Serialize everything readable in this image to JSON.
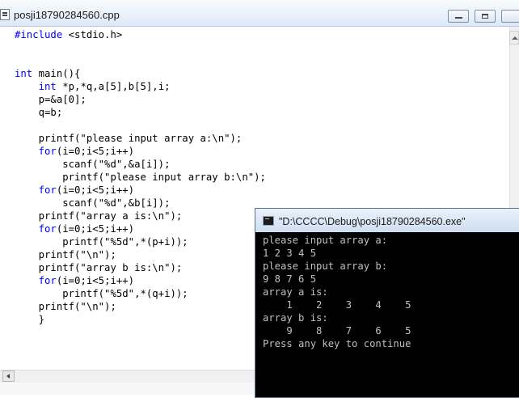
{
  "editor": {
    "title": "posji18790284560.cpp",
    "code_lines": [
      [
        {
          "t": "#include",
          "k": 1
        },
        {
          "t": " <stdio.h>"
        }
      ],
      [],
      [],
      [
        {
          "t": "int",
          "k": 1
        },
        {
          "t": " main(){"
        }
      ],
      [
        {
          "t": "    "
        },
        {
          "t": "int",
          "k": 1
        },
        {
          "t": " *p,*q,a[5],b[5],i;"
        }
      ],
      [
        {
          "t": "    p=&a[0];"
        }
      ],
      [
        {
          "t": "    q=b;"
        }
      ],
      [],
      [
        {
          "t": "    printf(\"please input array a:\\n\");"
        }
      ],
      [
        {
          "t": "    "
        },
        {
          "t": "for",
          "k": 1
        },
        {
          "t": "(i=0;i<5;i++)"
        }
      ],
      [
        {
          "t": "        scanf(\"%d\",&a[i]);"
        }
      ],
      [
        {
          "t": "        printf(\"please input array b:\\n\");"
        }
      ],
      [
        {
          "t": "    "
        },
        {
          "t": "for",
          "k": 1
        },
        {
          "t": "(i=0;i<5;i++)"
        }
      ],
      [
        {
          "t": "        scanf(\"%d\",&b[i]);"
        }
      ],
      [
        {
          "t": "    printf(\"array a is:\\n\");"
        }
      ],
      [
        {
          "t": "    "
        },
        {
          "t": "for",
          "k": 1
        },
        {
          "t": "(i=0;i<5;i++)"
        }
      ],
      [
        {
          "t": "        printf(\"%5d\",*(p+i));"
        }
      ],
      [
        {
          "t": "    printf(\"\\n\");"
        }
      ],
      [
        {
          "t": "    printf(\"array b is:\\n\");"
        }
      ],
      [
        {
          "t": "    "
        },
        {
          "t": "for",
          "k": 1
        },
        {
          "t": "(i=0;i<5;i++)"
        }
      ],
      [
        {
          "t": "        printf(\"%5d\",*(q+i));"
        }
      ],
      [
        {
          "t": "    printf(\"\\n\");"
        }
      ],
      [
        {
          "t": "    }"
        }
      ]
    ]
  },
  "console": {
    "title": "\"D:\\CCCC\\Debug\\posji18790284560.exe\"",
    "output_lines": [
      "please input array a:",
      "1 2 3 4 5",
      "please input array b:",
      "9 8 7 6 5",
      "array a is:",
      "    1    2    3    4    5",
      "array b is:",
      "    9    8    7    6    5",
      "Press any key to continue"
    ]
  },
  "icons": {
    "editor_window": "document-icon",
    "console_window": "console-icon",
    "minimize": "minimize-icon",
    "maximize": "maximize-icon",
    "scroll_up": "arrow-up-icon",
    "scroll_left": "arrow-left-icon"
  },
  "colors": {
    "keyword": "#0000ff",
    "console_bg": "#000000",
    "console_text": "#c0c0c0"
  }
}
